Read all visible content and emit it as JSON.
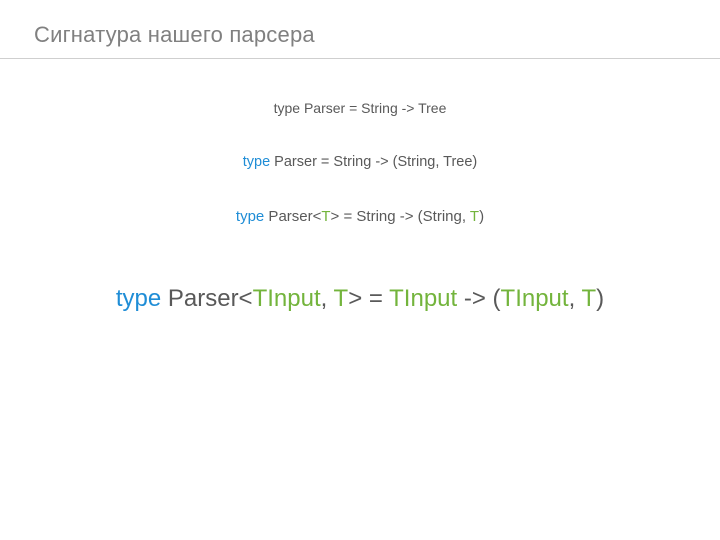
{
  "title": "Сигнатура нашего парсера",
  "line1": {
    "kw": "type",
    "mid": " Parser = String -> Tree"
  },
  "line2": {
    "kw": "type",
    "mid": " Parser = String -> (String, Tree)"
  },
  "line3": {
    "kw": "type",
    "mid1": " Parser<",
    "t1": "T",
    "mid2": "> = String -> (String, ",
    "t2": "T",
    "mid3": ")"
  },
  "line4": {
    "kw": "type",
    "mid1": " Parser<",
    "g1": "TInput",
    "comma1": ", ",
    "g2": "T",
    "mid2": "> = ",
    "g3": "TInput",
    "mid3": " -> (",
    "g4": "TInput",
    "comma2": ", ",
    "g5": "T",
    "mid4": ")"
  }
}
